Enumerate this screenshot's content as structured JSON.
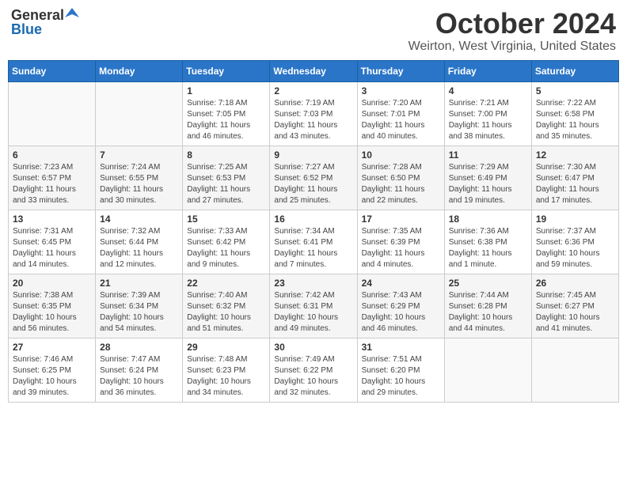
{
  "header": {
    "logo_general": "General",
    "logo_blue": "Blue",
    "month_title": "October 2024",
    "location": "Weirton, West Virginia, United States"
  },
  "days_of_week": [
    "Sunday",
    "Monday",
    "Tuesday",
    "Wednesday",
    "Thursday",
    "Friday",
    "Saturday"
  ],
  "weeks": [
    [
      {
        "day": "",
        "content": ""
      },
      {
        "day": "",
        "content": ""
      },
      {
        "day": "1",
        "content": "Sunrise: 7:18 AM\nSunset: 7:05 PM\nDaylight: 11 hours\nand 46 minutes."
      },
      {
        "day": "2",
        "content": "Sunrise: 7:19 AM\nSunset: 7:03 PM\nDaylight: 11 hours\nand 43 minutes."
      },
      {
        "day": "3",
        "content": "Sunrise: 7:20 AM\nSunset: 7:01 PM\nDaylight: 11 hours\nand 40 minutes."
      },
      {
        "day": "4",
        "content": "Sunrise: 7:21 AM\nSunset: 7:00 PM\nDaylight: 11 hours\nand 38 minutes."
      },
      {
        "day": "5",
        "content": "Sunrise: 7:22 AM\nSunset: 6:58 PM\nDaylight: 11 hours\nand 35 minutes."
      }
    ],
    [
      {
        "day": "6",
        "content": "Sunrise: 7:23 AM\nSunset: 6:57 PM\nDaylight: 11 hours\nand 33 minutes."
      },
      {
        "day": "7",
        "content": "Sunrise: 7:24 AM\nSunset: 6:55 PM\nDaylight: 11 hours\nand 30 minutes."
      },
      {
        "day": "8",
        "content": "Sunrise: 7:25 AM\nSunset: 6:53 PM\nDaylight: 11 hours\nand 27 minutes."
      },
      {
        "day": "9",
        "content": "Sunrise: 7:27 AM\nSunset: 6:52 PM\nDaylight: 11 hours\nand 25 minutes."
      },
      {
        "day": "10",
        "content": "Sunrise: 7:28 AM\nSunset: 6:50 PM\nDaylight: 11 hours\nand 22 minutes."
      },
      {
        "day": "11",
        "content": "Sunrise: 7:29 AM\nSunset: 6:49 PM\nDaylight: 11 hours\nand 19 minutes."
      },
      {
        "day": "12",
        "content": "Sunrise: 7:30 AM\nSunset: 6:47 PM\nDaylight: 11 hours\nand 17 minutes."
      }
    ],
    [
      {
        "day": "13",
        "content": "Sunrise: 7:31 AM\nSunset: 6:45 PM\nDaylight: 11 hours\nand 14 minutes."
      },
      {
        "day": "14",
        "content": "Sunrise: 7:32 AM\nSunset: 6:44 PM\nDaylight: 11 hours\nand 12 minutes."
      },
      {
        "day": "15",
        "content": "Sunrise: 7:33 AM\nSunset: 6:42 PM\nDaylight: 11 hours\nand 9 minutes."
      },
      {
        "day": "16",
        "content": "Sunrise: 7:34 AM\nSunset: 6:41 PM\nDaylight: 11 hours\nand 7 minutes."
      },
      {
        "day": "17",
        "content": "Sunrise: 7:35 AM\nSunset: 6:39 PM\nDaylight: 11 hours\nand 4 minutes."
      },
      {
        "day": "18",
        "content": "Sunrise: 7:36 AM\nSunset: 6:38 PM\nDaylight: 11 hours\nand 1 minute."
      },
      {
        "day": "19",
        "content": "Sunrise: 7:37 AM\nSunset: 6:36 PM\nDaylight: 10 hours\nand 59 minutes."
      }
    ],
    [
      {
        "day": "20",
        "content": "Sunrise: 7:38 AM\nSunset: 6:35 PM\nDaylight: 10 hours\nand 56 minutes."
      },
      {
        "day": "21",
        "content": "Sunrise: 7:39 AM\nSunset: 6:34 PM\nDaylight: 10 hours\nand 54 minutes."
      },
      {
        "day": "22",
        "content": "Sunrise: 7:40 AM\nSunset: 6:32 PM\nDaylight: 10 hours\nand 51 minutes."
      },
      {
        "day": "23",
        "content": "Sunrise: 7:42 AM\nSunset: 6:31 PM\nDaylight: 10 hours\nand 49 minutes."
      },
      {
        "day": "24",
        "content": "Sunrise: 7:43 AM\nSunset: 6:29 PM\nDaylight: 10 hours\nand 46 minutes."
      },
      {
        "day": "25",
        "content": "Sunrise: 7:44 AM\nSunset: 6:28 PM\nDaylight: 10 hours\nand 44 minutes."
      },
      {
        "day": "26",
        "content": "Sunrise: 7:45 AM\nSunset: 6:27 PM\nDaylight: 10 hours\nand 41 minutes."
      }
    ],
    [
      {
        "day": "27",
        "content": "Sunrise: 7:46 AM\nSunset: 6:25 PM\nDaylight: 10 hours\nand 39 minutes."
      },
      {
        "day": "28",
        "content": "Sunrise: 7:47 AM\nSunset: 6:24 PM\nDaylight: 10 hours\nand 36 minutes."
      },
      {
        "day": "29",
        "content": "Sunrise: 7:48 AM\nSunset: 6:23 PM\nDaylight: 10 hours\nand 34 minutes."
      },
      {
        "day": "30",
        "content": "Sunrise: 7:49 AM\nSunset: 6:22 PM\nDaylight: 10 hours\nand 32 minutes."
      },
      {
        "day": "31",
        "content": "Sunrise: 7:51 AM\nSunset: 6:20 PM\nDaylight: 10 hours\nand 29 minutes."
      },
      {
        "day": "",
        "content": ""
      },
      {
        "day": "",
        "content": ""
      }
    ]
  ]
}
